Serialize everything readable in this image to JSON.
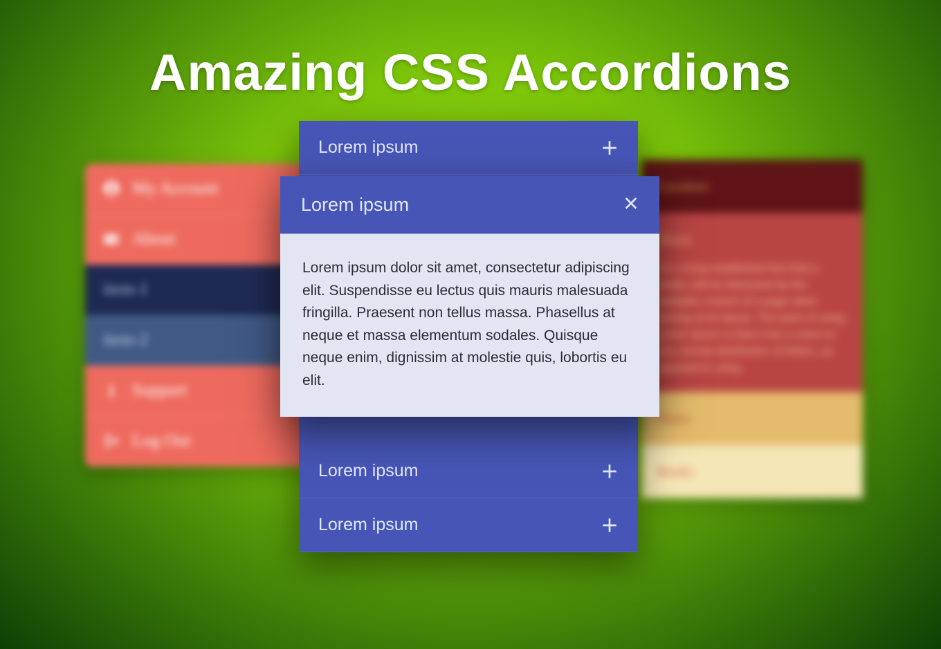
{
  "title": "Amazing CSS Accordions",
  "left_panel": {
    "items": [
      {
        "icon": "user-circle-icon",
        "label": "My Account"
      },
      {
        "icon": "id-card-icon",
        "label": "About"
      },
      {
        "icon": "",
        "label": "item-1"
      },
      {
        "icon": "",
        "label": "item-2"
      },
      {
        "icon": "info-icon",
        "label": "Support"
      },
      {
        "icon": "logout-icon",
        "label": "Log Out"
      }
    ]
  },
  "right_panel": {
    "items": [
      {
        "label": "Location"
      },
      {
        "label": "Music"
      }
    ],
    "body": "It is a long established fact that a reader will be distracted by the readable content of a page when looking at its layout. The point of using Lorem Ipsum is that it has a more-or-less normal distribution of letters, as opposed to using",
    "tail": [
      {
        "label": "Notes"
      },
      {
        "label": "Books"
      }
    ]
  },
  "center": {
    "rows": [
      {
        "label": "Lorem ipsum",
        "state": "collapsed"
      },
      {
        "label": "Lorem ipsum",
        "state": "expanded",
        "body": "Lorem ipsum dolor sit amet, consectetur adipiscing elit. Suspendisse eu lectus quis mauris malesuada fringilla. Praesent non tellus massa. Phasellus at neque et massa elementum sodales. Quisque neque enim, dignissim at molestie quis, lobortis eu elit."
      },
      {
        "label": "Lorem ipsum",
        "state": "collapsed"
      },
      {
        "label": "Lorem ipsum",
        "state": "collapsed"
      }
    ]
  }
}
